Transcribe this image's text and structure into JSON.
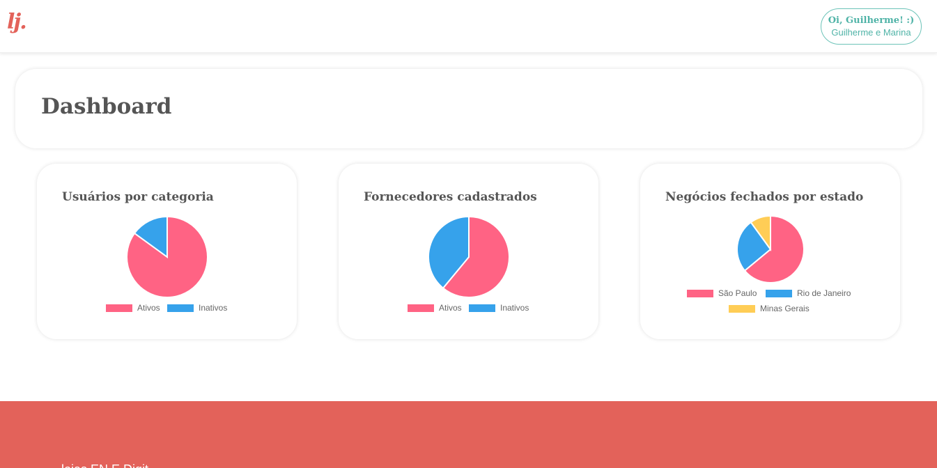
{
  "header": {
    "logo": "lj.",
    "greeting": "Oi, Guilherme! :)",
    "account": "Guilherme e Marina"
  },
  "page": {
    "title": "Dashboard"
  },
  "colors": {
    "pink": "#ff6384",
    "blue": "#36a2eb",
    "yellow": "#ffcd56",
    "accent": "#e3625a",
    "teal": "#4fb3a7"
  },
  "footer": {
    "text": "lojas EN E Digit..."
  },
  "chart_data": [
    {
      "type": "pie",
      "title": "Usuários por categoria",
      "categories": [
        "Ativos",
        "Inativos"
      ],
      "values": [
        85,
        15
      ],
      "legend": "bottom"
    },
    {
      "type": "pie",
      "title": "Fornecedores cadastrados",
      "categories": [
        "Ativos",
        "Inativos"
      ],
      "values": [
        61,
        39
      ],
      "legend": "bottom"
    },
    {
      "type": "pie",
      "title": "Negócios fechados por estado",
      "categories": [
        "São Paulo",
        "Rio de Janeiro",
        "Minas Gerais"
      ],
      "values": [
        64,
        26,
        10
      ],
      "legend": "bottom"
    }
  ]
}
